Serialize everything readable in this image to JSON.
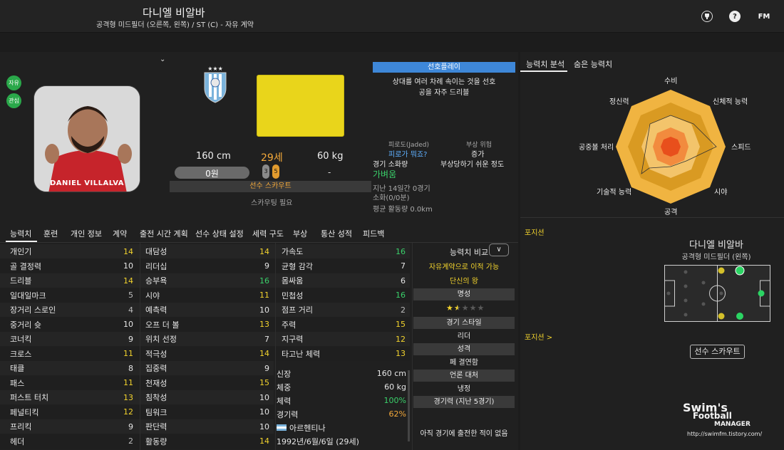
{
  "header": {
    "player_name": "다니엘 비알바",
    "position_line": "공격형 미드필더 (오른쪽, 왼쪽) / ST (C) - 자유 계약",
    "icons": [
      "trophy-icon",
      "help-icon",
      "fm-logo-icon"
    ],
    "fm_label": "FM"
  },
  "left": {
    "badges": [
      "자유",
      "관심"
    ],
    "photo_caption": "DANIEL VILLALVA",
    "height": "160 cm",
    "age": "29세",
    "weight": "60 kg",
    "wage": "0원",
    "value": "-",
    "agent_nums": [
      "3",
      "5"
    ],
    "scout_bar": "선수 스카우트",
    "scout_needed": "스카우팅 필요",
    "pref_header": "선호플레이",
    "pref_lines": [
      "상대를 여러 차례 속이는 것을 선호",
      "공을 자주 드리블"
    ],
    "fatigue_label": "피로도(Jaded)",
    "fatigue_value": "피로가 뭐죠?",
    "injury_label": "부상 위험",
    "injury_value": "증가",
    "injury_desc": "부상당하기 쉬운 정도",
    "match_load_label": "경기 소화량",
    "match_load_value": "가벼움",
    "last14": "지난 14일간 0경기",
    "last14_sub": "소화(0/0분)",
    "avg_distance": "평균 활동량 0.0km"
  },
  "tabs": [
    "능력치",
    "훈련",
    "개인 정보",
    "계약",
    "출전 시간 계획",
    "선수 상태 설정",
    "세력 구도",
    "부상",
    "통산 성적",
    "피드백"
  ],
  "attributes": {
    "col1": [
      {
        "name": "개인기",
        "value": "14",
        "tone": "yellow"
      },
      {
        "name": "골 결정력",
        "value": "10",
        "tone": "white"
      },
      {
        "name": "드리블",
        "value": "14",
        "tone": "yellow"
      },
      {
        "name": "일대일마크",
        "value": "5",
        "tone": "gray"
      },
      {
        "name": "장거리 스로인",
        "value": "4",
        "tone": "gray"
      },
      {
        "name": "중거리 슛",
        "value": "10",
        "tone": "white"
      },
      {
        "name": "코너킥",
        "value": "9",
        "tone": "white"
      },
      {
        "name": "크로스",
        "value": "11",
        "tone": "yellow"
      },
      {
        "name": "태클",
        "value": "8",
        "tone": "white"
      },
      {
        "name": "패스",
        "value": "11",
        "tone": "yellow"
      },
      {
        "name": "퍼스트 터치",
        "value": "13",
        "tone": "yellow"
      },
      {
        "name": "페널티킥",
        "value": "12",
        "tone": "yellow"
      },
      {
        "name": "프리킥",
        "value": "9",
        "tone": "white"
      },
      {
        "name": "헤더",
        "value": "2",
        "tone": "gray"
      }
    ],
    "col2": [
      {
        "name": "대담성",
        "value": "14",
        "tone": "yellow"
      },
      {
        "name": "리더십",
        "value": "9",
        "tone": "white"
      },
      {
        "name": "승부욕",
        "value": "16",
        "tone": "green"
      },
      {
        "name": "시야",
        "value": "11",
        "tone": "yellow"
      },
      {
        "name": "예측력",
        "value": "10",
        "tone": "white"
      },
      {
        "name": "오프 더 볼",
        "value": "13",
        "tone": "yellow"
      },
      {
        "name": "위치 선정",
        "value": "7",
        "tone": "white"
      },
      {
        "name": "적극성",
        "value": "14",
        "tone": "yellow"
      },
      {
        "name": "집중력",
        "value": "9",
        "tone": "white"
      },
      {
        "name": "천재성",
        "value": "15",
        "tone": "yellow"
      },
      {
        "name": "침착성",
        "value": "10",
        "tone": "white"
      },
      {
        "name": "팀워크",
        "value": "10",
        "tone": "white"
      },
      {
        "name": "판단력",
        "value": "10",
        "tone": "white"
      },
      {
        "name": "활동량",
        "value": "14",
        "tone": "yellow"
      }
    ],
    "col3": [
      {
        "name": "가속도",
        "value": "16",
        "tone": "green"
      },
      {
        "name": "균형 감각",
        "value": "7",
        "tone": "white"
      },
      {
        "name": "몸싸움",
        "value": "6",
        "tone": "white"
      },
      {
        "name": "민첩성",
        "value": "16",
        "tone": "green"
      },
      {
        "name": "점프 거리",
        "value": "2",
        "tone": "gray"
      },
      {
        "name": "주력",
        "value": "15",
        "tone": "yellow"
      },
      {
        "name": "지구력",
        "value": "12",
        "tone": "yellow"
      },
      {
        "name": "타고난 체력",
        "value": "13",
        "tone": "yellow"
      }
    ]
  },
  "physical": [
    {
      "label": "신장",
      "value": "160 cm",
      "tone": "white"
    },
    {
      "label": "체중",
      "value": "60 kg",
      "tone": "white"
    },
    {
      "label": "체력",
      "value": "100%",
      "tone": "green"
    },
    {
      "label": "경기력",
      "value": "62%",
      "tone": "orange"
    }
  ],
  "nationality": "아르헨티나",
  "birth": "1992년/6월/6일 (29세)",
  "sidebar": {
    "compare_label": "능력치 비교",
    "compare_btn": "∨",
    "transfer_note": "자유계약으로 이적 가능",
    "club_label": "단신의 왕",
    "reputation_head": "명성",
    "reputation_stars": 1.5,
    "style_head": "경기 스타일",
    "style_value": "리더",
    "personality_head": "성격",
    "personality_value": "페 결연함",
    "media_head": "언론 대처",
    "media_value": "냉정",
    "form_head": "경기력 (지난 5경기)",
    "form_value": "아직 경기에 출전한 적이 없음"
  },
  "right": {
    "tabs": [
      "능력치 분석",
      "숨은 능력치"
    ],
    "radar_labels": [
      "수비",
      "신체적 능력",
      "스피드",
      "시야",
      "공격",
      "기술적 능력",
      "공중볼 처리",
      "정신력"
    ],
    "positions_head": "포지션",
    "positions_link": "포지션 >",
    "card_name": "다니엘 비알바",
    "card_position": "공격형 미드필더 (왼쪽)",
    "scout_button": "선수 스카우트",
    "logo_line1": "Swim's",
    "logo_line2": "Football",
    "logo_line3": "MANAGER",
    "logo_url": "http://swimfm.tistory.com/"
  },
  "colors": {
    "accent_blue": "#3e87d8",
    "good_green": "#3ad06a",
    "mid_yellow": "#f2d32d",
    "radar_outer": "#f0b441",
    "radar_inner": "#e84f1c"
  }
}
